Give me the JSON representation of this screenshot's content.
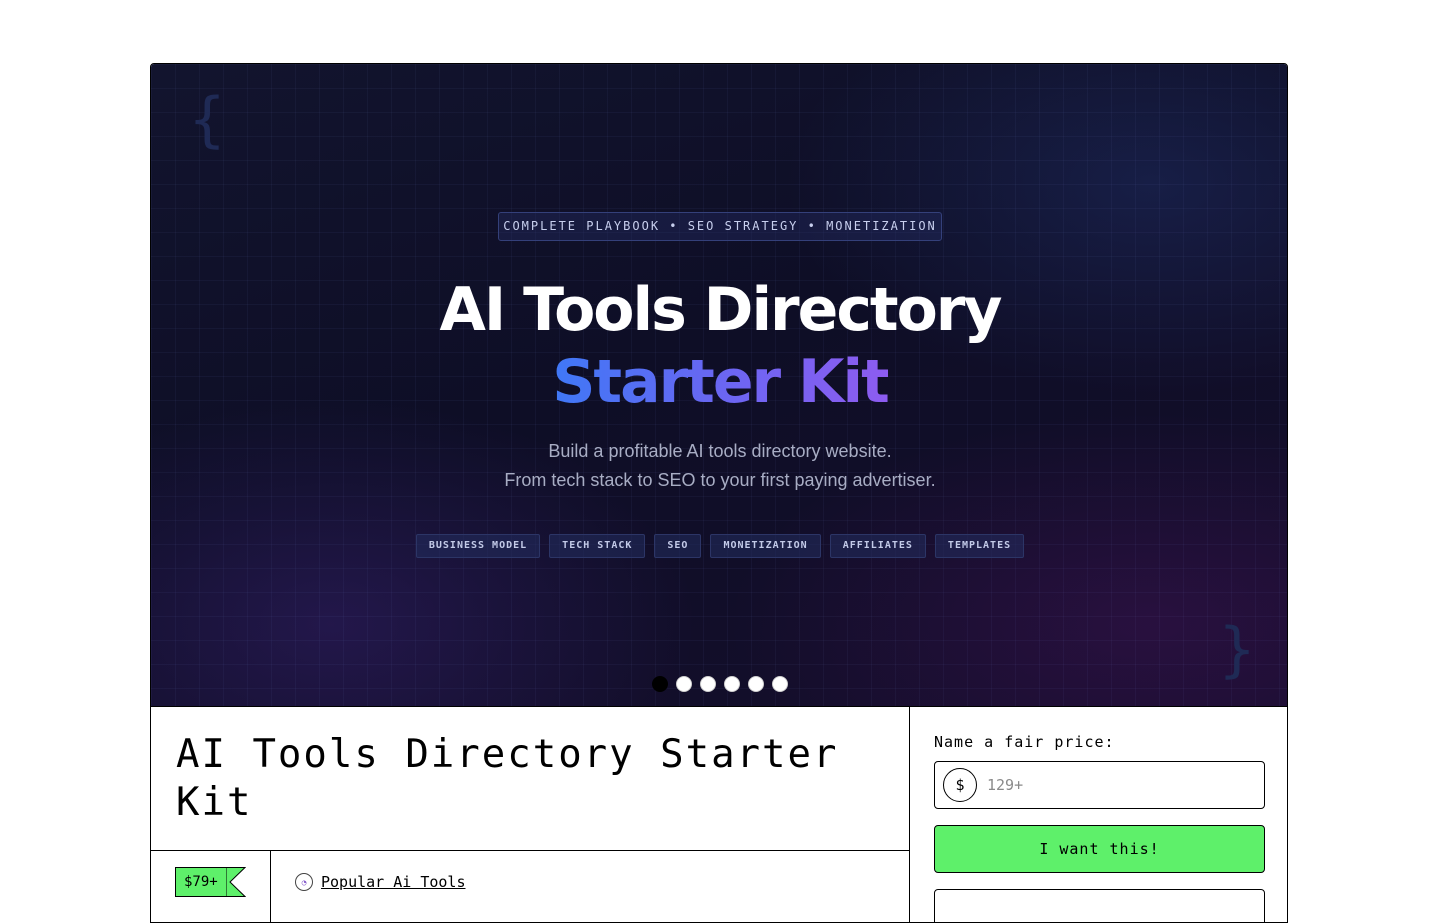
{
  "hero": {
    "brace_left": "{",
    "brace_right": "}",
    "pill": "COMPLETE PLAYBOOK • SEO STRATEGY • MONETIZATION",
    "title_line1": "AI Tools Directory",
    "title_line2": "Starter Kit",
    "subtitle_line1": "Build a profitable AI tools directory website.",
    "subtitle_line2": "From tech stack to SEO to your first paying advertiser.",
    "tags": [
      "BUSINESS MODEL",
      "TECH STACK",
      "SEO",
      "MONETIZATION",
      "AFFILIATES",
      "TEMPLATES"
    ],
    "carousel": {
      "count": 6,
      "active_index": 0
    },
    "colors": {
      "gradient_start": "#3f78f6",
      "gradient_end": "#8d5cf0",
      "background": "#0e0e26"
    }
  },
  "product": {
    "title": "AI Tools Directory Starter Kit",
    "price_tag": "$79+",
    "author_name": "Popular Ai Tools",
    "price_tag_color": "#5ef06a"
  },
  "purchase": {
    "fair_price_label": "Name a fair price:",
    "currency_symbol": "$",
    "price_placeholder": "129+",
    "want_button": "I want this!",
    "button_color": "#5ef06a"
  }
}
